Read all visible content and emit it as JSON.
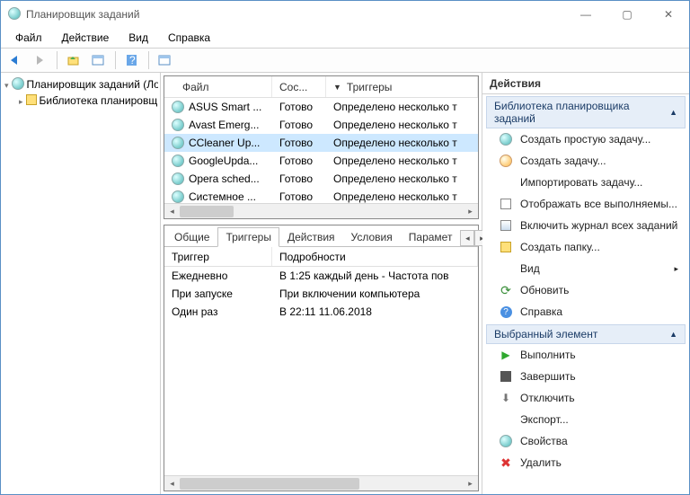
{
  "title": "Планировщик заданий",
  "menus": [
    "Файл",
    "Действие",
    "Вид",
    "Справка"
  ],
  "tree": {
    "root": "Планировщик заданий (Лок",
    "child": "Библиотека планировщ"
  },
  "list": {
    "cols": [
      "Файл",
      "Сос...",
      "Триггеры"
    ],
    "rows": [
      {
        "name": "ASUS Smart ...",
        "state": "Готово",
        "trig": "Определено несколько т"
      },
      {
        "name": "Avast Emerg...",
        "state": "Готово",
        "trig": "Определено несколько т"
      },
      {
        "name": "CCleaner Up...",
        "state": "Готово",
        "trig": "Определено несколько т",
        "sel": true
      },
      {
        "name": "GoogleUpda...",
        "state": "Готово",
        "trig": "Определено несколько т"
      },
      {
        "name": "Opera sched...",
        "state": "Готово",
        "trig": "Определено несколько т"
      },
      {
        "name": "Системное ...",
        "state": "Готово",
        "trig": "Определено несколько т"
      }
    ]
  },
  "tabs": [
    "Общие",
    "Триггеры",
    "Действия",
    "Условия",
    "Парамет"
  ],
  "active_tab": 1,
  "triggers": {
    "cols": [
      "Триггер",
      "Подробности"
    ],
    "rows": [
      {
        "t": "Ежедневно",
        "d": "В 1:25 каждый день - Частота пов"
      },
      {
        "t": "При запуске",
        "d": "При включении компьютера"
      },
      {
        "t": "Один раз",
        "d": "В 22:11 11.06.2018"
      }
    ]
  },
  "actions": {
    "title": "Действия",
    "group1": "Библиотека планировщика заданий",
    "items1": [
      "Создать простую задачу...",
      "Создать задачу...",
      "Импортировать задачу...",
      "Отображать все выполняемы...",
      "Включить журнал всех заданий",
      "Создать папку...",
      "Вид",
      "Обновить",
      "Справка"
    ],
    "group2": "Выбранный элемент",
    "items2": [
      "Выполнить",
      "Завершить",
      "Отключить",
      "Экспорт...",
      "Свойства",
      "Удалить"
    ]
  }
}
